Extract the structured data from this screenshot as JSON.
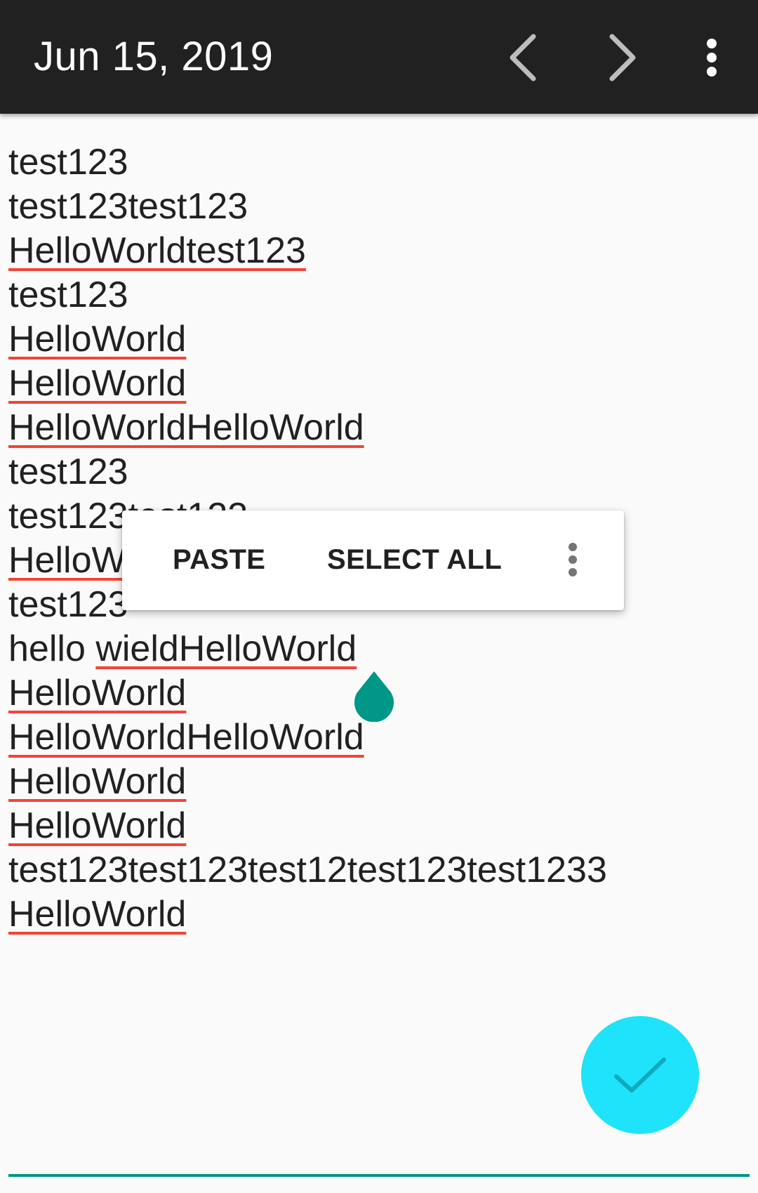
{
  "appbar": {
    "title": "Jun 15, 2019",
    "prev_icon": "chevron-left-icon",
    "next_icon": "chevron-right-icon",
    "more_icon": "more-vert-icon"
  },
  "editor": {
    "lines": [
      "test123",
      "test123test123",
      "HelloWorldtest123",
      "test123",
      "HelloWorld",
      "HelloWorld",
      "HelloWorldHelloWorld",
      "test123",
      "test123test123",
      "HelloWorld",
      "test123",
      "hello wieldHelloWorld",
      "HelloWorld",
      "HelloWorldHelloWorld",
      "HelloWorld",
      "HelloWorld",
      "test123test123test12test123test1233",
      "HelloWorld"
    ],
    "line11_part1": "hello ",
    "line11_part2": "wieldHelloWorld"
  },
  "context_menu": {
    "paste_label": "PASTE",
    "select_all_label": "SELECT ALL",
    "more_icon": "more-vert-icon"
  },
  "fab": {
    "icon": "check-icon"
  },
  "colors": {
    "appbar_bg": "#212121",
    "background": "#fafafa",
    "spell_underline": "#f44336",
    "accent": "#009688",
    "fab": "#1ee3fa"
  }
}
